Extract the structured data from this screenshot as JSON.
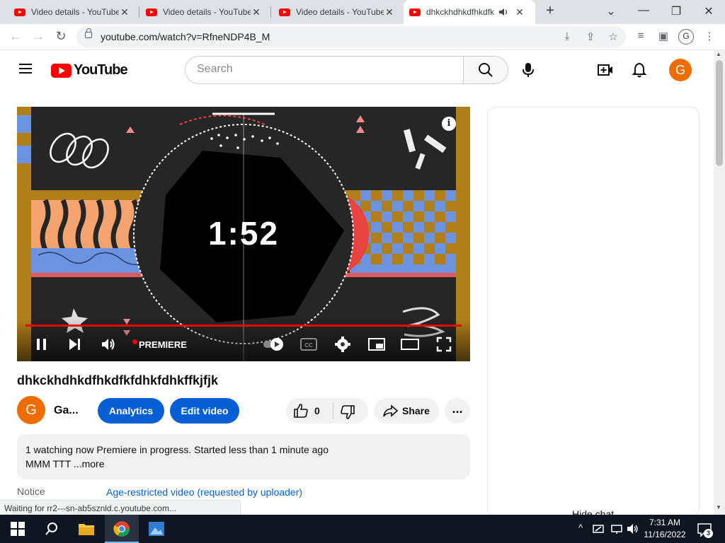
{
  "browser": {
    "tabs": [
      {
        "title": "Video details - YouTube Studio",
        "active": false
      },
      {
        "title": "Video details - YouTube Studio",
        "active": false
      },
      {
        "title": "Video details - YouTube Studio",
        "active": false
      },
      {
        "title": "dhkckhdhkdfhkdfkfdhkfdhkffkjfjk - YouTube",
        "active": true
      }
    ],
    "new_tab_icon": "plus-icon",
    "url": "youtube.com/watch?v=RfneNDP4B_M",
    "profile_letter": "G"
  },
  "header": {
    "logo_text": "YouTube",
    "search_placeholder": "Search",
    "avatar_letter": "G"
  },
  "player": {
    "countdown": "1:52",
    "premiere_label": "PREMIERE",
    "progress": 1.0
  },
  "video": {
    "title": "dhkckhdhkdfhkdfkfdhkfdhkffkjfjk",
    "channel_letter": "G",
    "channel_name": "Ga...",
    "analytics_label": "Analytics",
    "edit_label": "Edit video",
    "like_count": "0",
    "share_label": "Share",
    "more_label": "..."
  },
  "description": {
    "line1": "1 watching now  Premiere in progress. Started less than 1 minute ago",
    "line2": "MMM TTT",
    "more": "...more"
  },
  "notice": {
    "label": "Notice",
    "link": "Age-restricted video (requested by uploader)"
  },
  "side": {
    "hide_chat": "Hide chat"
  },
  "status_bar": "Waiting for rr2---sn-ab5sznld.c.youtube.com...",
  "taskbar": {
    "time": "7:31 AM",
    "date": "11/16/2022",
    "notification_count": "3"
  },
  "colors": {
    "brand_red": "#ff0000",
    "accent_blue": "#065fd4",
    "avatar_orange": "#ef6c00"
  }
}
